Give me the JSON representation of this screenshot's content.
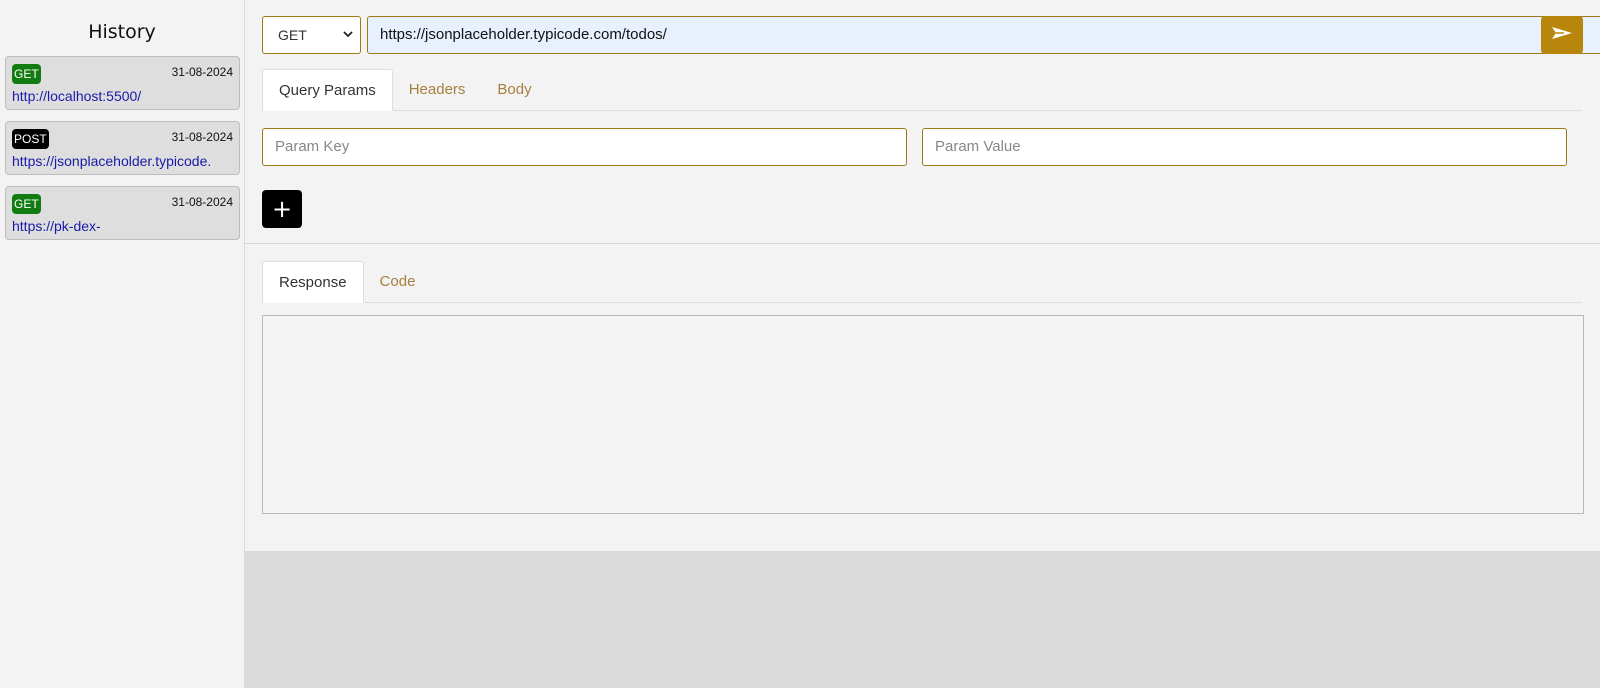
{
  "sidebar": {
    "title": "History",
    "items": [
      {
        "method": "GET",
        "date": "31-08-2024",
        "url": "http://localhost:5500/"
      },
      {
        "method": "POST",
        "date": "31-08-2024",
        "url": "https://jsonplaceholder.typicode."
      },
      {
        "method": "GET",
        "date": "31-08-2024",
        "url": "https://pk-dex-"
      }
    ]
  },
  "request": {
    "method": "GET",
    "url": "https://jsonplaceholder.typicode.com/todos/",
    "send_icon": "send-icon",
    "tabs": [
      "Query Params",
      "Headers",
      "Body"
    ],
    "active_tab": "Query Params",
    "param_key_placeholder": "Param Key",
    "param_value_placeholder": "Param Value",
    "add_label": "+"
  },
  "response": {
    "tabs": [
      "Response",
      "Code"
    ],
    "active_tab": "Response"
  },
  "colors": {
    "accent": "#b8860b",
    "get_badge": "#127b12",
    "post_badge": "#000000",
    "link": "#1a1aa8",
    "inactive_tab": "#a57f3e"
  }
}
